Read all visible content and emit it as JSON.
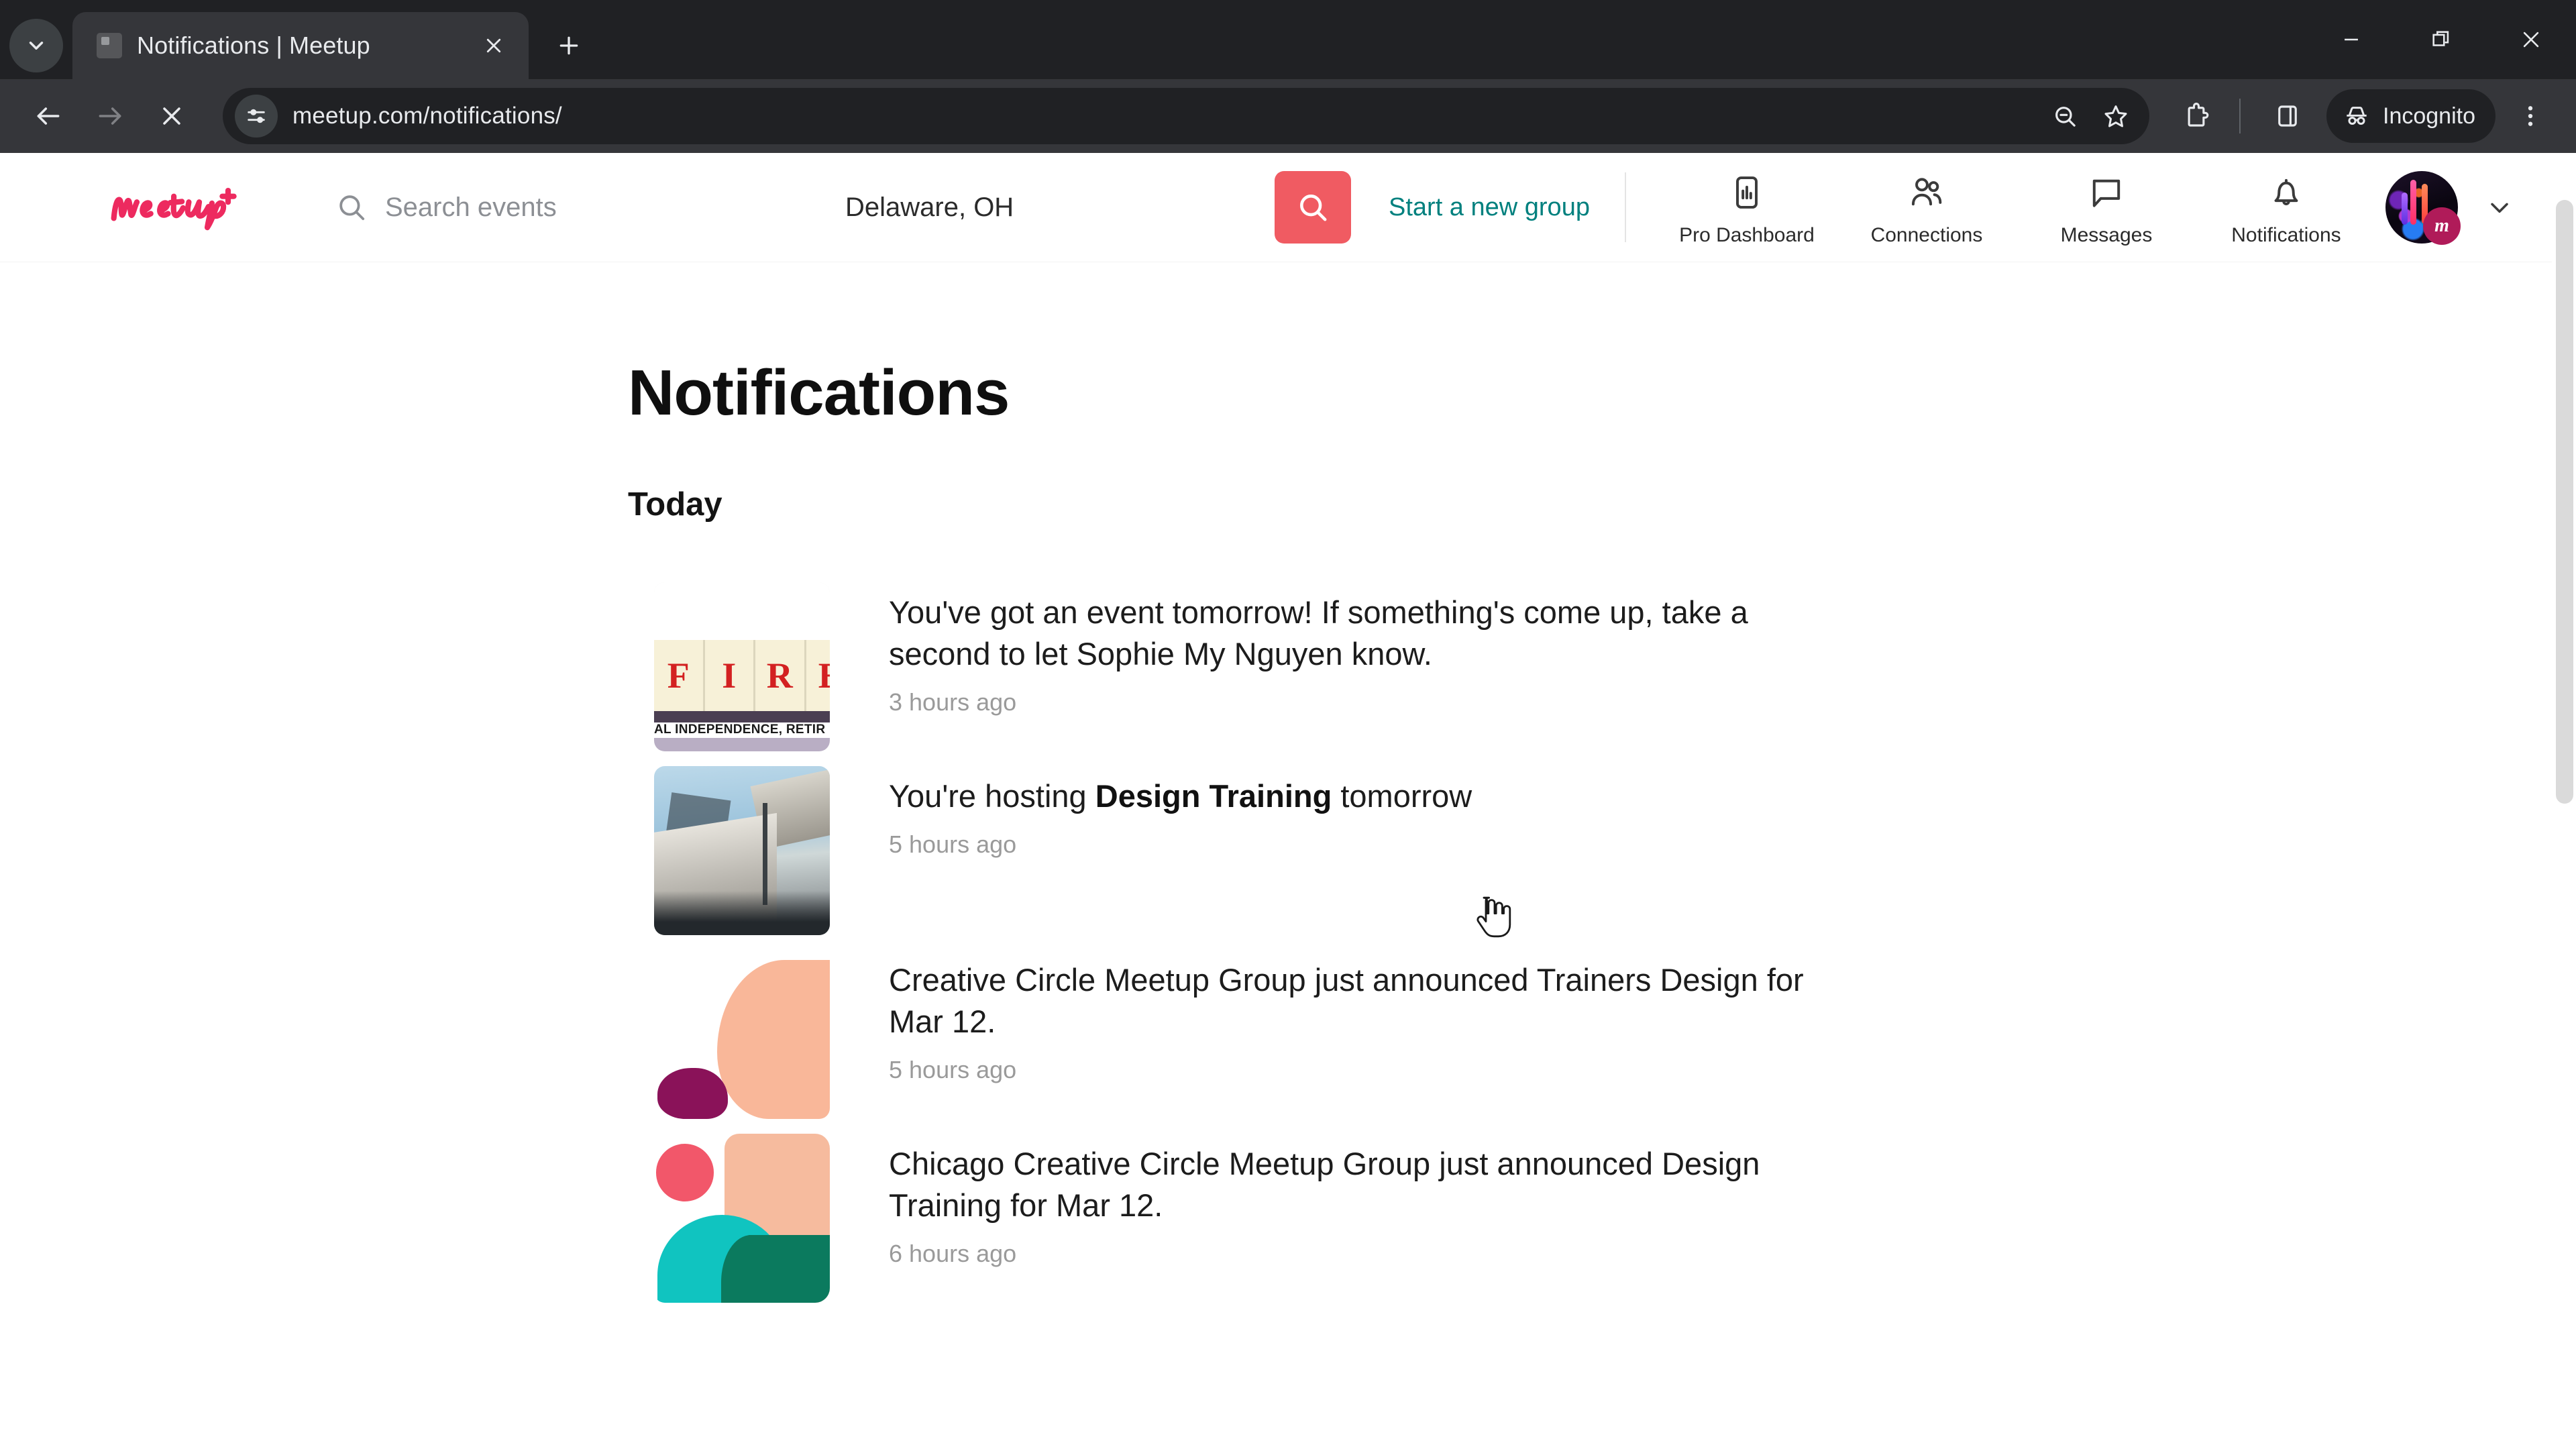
{
  "browser": {
    "tab": {
      "title": "Notifications | Meetup",
      "favicon_name": "meetup-favicon"
    },
    "tab_actions": {
      "close": "×",
      "new_tab": "+",
      "tab_search": "⌄"
    },
    "window_controls": {
      "minimize": "–",
      "maximize": "❐",
      "close": "✕"
    },
    "nav": {
      "back": "←",
      "forward": "→",
      "stop": "✕"
    },
    "omnibox": {
      "url": "meetup.com/notifications/",
      "site_info_icon": "tune-icon",
      "zoom_out_icon": "zoom-out-icon",
      "bookmark_icon": "star-icon"
    },
    "toolbar": {
      "extensions_icon": "puzzle-icon",
      "side_panel_icon": "side-panel-icon",
      "incognito_label": "Incognito",
      "menu_icon": "three-dot-menu-icon"
    }
  },
  "site": {
    "logo_text": "Meetup",
    "search": {
      "placeholder": "Search events",
      "icon": "search-icon"
    },
    "location": {
      "value": "Delaware, OH"
    },
    "search_button": {
      "icon": "search-icon"
    },
    "start_group_link": "Start a new group",
    "nav_items": [
      {
        "label": "Pro Dashboard",
        "icon": "pro-dashboard-icon"
      },
      {
        "label": "Connections",
        "icon": "connections-icon"
      },
      {
        "label": "Messages",
        "icon": "message-icon"
      },
      {
        "label": "Notifications",
        "icon": "bell-icon"
      }
    ],
    "account": {
      "badge_text": "m",
      "chevron": "chevron-down-icon"
    }
  },
  "page": {
    "title": "Notifications",
    "section_label": "Today",
    "notifications": [
      {
        "text_before": "You've got an event tomorrow! If something's come up, take a second to let Sophie My Nguyen know.",
        "bold": "",
        "text_after": "",
        "time": "3 hours ago",
        "thumb": "fire-tiles-photo",
        "thumb_tiles": [
          "F",
          "I",
          "R",
          "E"
        ],
        "thumb_caption": "AL INDEPENDENCE, RETIR"
      },
      {
        "text_before": "You're hosting ",
        "bold": "Design Training",
        "text_after": " tomorrow",
        "time": "5 hours ago",
        "thumb": "city-building-photo"
      },
      {
        "text_before": "Creative Circle Meetup Group just announced Trainers Design for Mar 12.",
        "bold": "",
        "text_after": "",
        "time": "5 hours ago",
        "thumb": "abstract-peach-magenta"
      },
      {
        "text_before": "Chicago Creative Circle Meetup Group just announced Design Training for Mar 12.",
        "bold": "",
        "text_after": "",
        "time": "6 hours ago",
        "thumb": "abstract-pink-teal-peach"
      }
    ]
  },
  "colors": {
    "meetup_red": "#f05b62",
    "meetup_logo": "#ed2a5f",
    "teal_link": "#00807e",
    "chrome_dark": "#202124",
    "chrome_toolbar": "#35363a"
  }
}
